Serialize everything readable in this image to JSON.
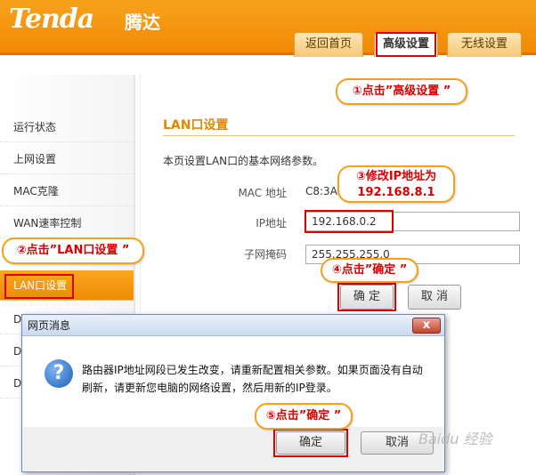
{
  "header": {
    "logo": "Tenda",
    "logo_cn": "腾达",
    "tabs": [
      {
        "label": "返回首页"
      },
      {
        "label": "高级设置"
      },
      {
        "label": "无线设置"
      }
    ]
  },
  "sidebar": {
    "items": [
      {
        "label": "运行状态"
      },
      {
        "label": "上网设置"
      },
      {
        "label": "MAC克隆"
      },
      {
        "label": "WAN速率控制"
      },
      {
        "label": "LAN口设置"
      },
      {
        "label": "DI"
      },
      {
        "label": "DI"
      },
      {
        "label": "DI"
      }
    ]
  },
  "main": {
    "section_title": "LAN口设置",
    "description": "本页设置LAN口的基本网络参数。",
    "mac_label": "MAC 地址",
    "mac_value": "C8:3A:",
    "ip_label": "IP地址",
    "ip_value": "192.168.0.2",
    "mask_label": "子网掩码",
    "mask_value": "255.255.255.0",
    "ok_button": "确 定",
    "cancel_button": "取 消"
  },
  "callouts": {
    "step1": "①点击”高级设置 ”",
    "step2": "②点击”LAN口设置 ”",
    "step3_line1": "③修改IP地址为",
    "step3_line2": "192.168.8.1",
    "step4": "④点击”确定 ”",
    "step5": "⑤点击”确定 ”"
  },
  "dialog": {
    "title": "网页消息",
    "close": "x",
    "icon": "?",
    "message": "路由器IP地址网段已发生改变，请重新配置相关参数。如果页面没有自动刷新，请更新您电脑的网络设置，然后用新的IP登录。",
    "ok_button": "确定",
    "cancel_button": "取消"
  },
  "watermark": "Baidu 经验"
}
